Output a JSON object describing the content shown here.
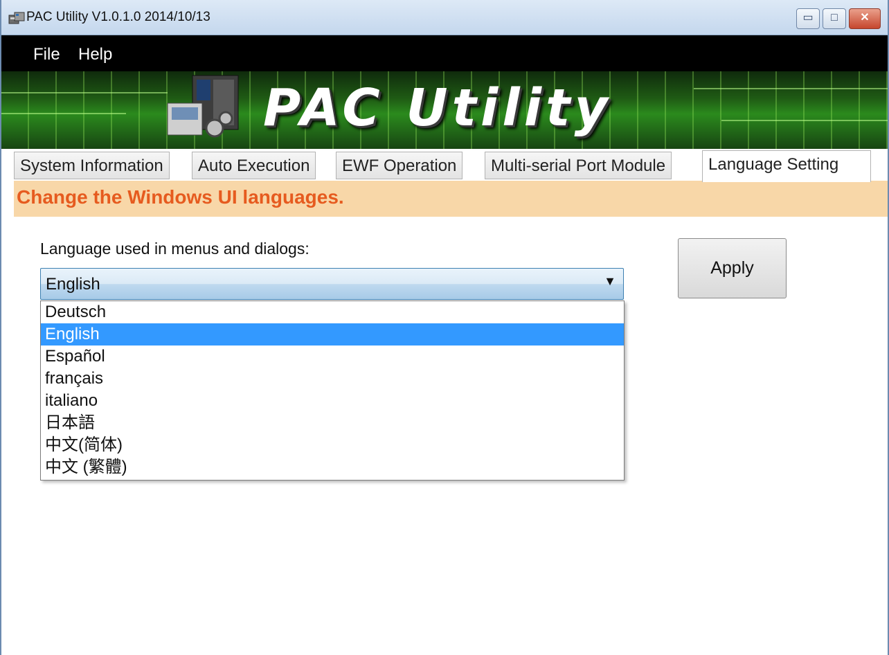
{
  "window": {
    "title": "PAC Utility V1.0.1.0  2014/10/13",
    "controls": {
      "minimize": "▭",
      "maximize": "□",
      "close": "✕"
    }
  },
  "menu": {
    "file": "File",
    "help": "Help"
  },
  "banner": {
    "logo_text": "PAC Utility"
  },
  "tabs": [
    {
      "label": "System Information",
      "active": false
    },
    {
      "label": "Auto Execution",
      "active": false
    },
    {
      "label": "EWF Operation",
      "active": false
    },
    {
      "label": "Multi-serial Port Module",
      "active": false
    },
    {
      "label": "Language Setting",
      "active": true
    }
  ],
  "page": {
    "header": "Change the Windows UI languages.",
    "language_label": "Language used in menus and dialogs:",
    "selected_language": "English",
    "options": [
      "Deutsch",
      "English",
      "Español",
      "français",
      "italiano",
      "日本語",
      "中文(简体)",
      "中文 (繁體)"
    ],
    "apply_label": "Apply"
  },
  "colors": {
    "header_bg": "#f8d7a8",
    "header_text": "#e65b1f",
    "selection": "#3399ff",
    "menubar": "#000000"
  },
  "icons": {
    "app": "pac-device-icon",
    "dropdown": "chevron-down-icon"
  }
}
